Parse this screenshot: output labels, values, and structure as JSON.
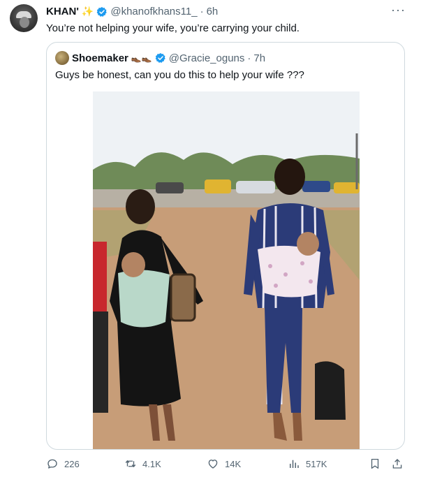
{
  "author": {
    "name": "KHAN'",
    "emoji": "✨",
    "handle": "@khanofkhans11_",
    "separator": "·",
    "time": "6h",
    "more_label": "···"
  },
  "tweet_text": "You’re not helping your wife, you’re carrying your child.",
  "quoted": {
    "name": "Shoemaker",
    "emoji": "👞👞",
    "handle": "@Gracie_oguns",
    "separator": "·",
    "time": "7h",
    "text": "Guys be honest, can you do this to help your wife ???"
  },
  "metrics": {
    "replies": "226",
    "reposts": "4.1K",
    "likes": "14K",
    "views": "517K"
  },
  "icons": {
    "reply": "speech-bubble-icon",
    "repost": "repost-arrows-icon",
    "like": "heart-icon",
    "views": "bar-chart-icon",
    "bookmark": "bookmark-icon",
    "share": "share-upload-icon",
    "verified": "verified-badge-icon"
  },
  "colors": {
    "verified": "#1d9bf0",
    "text": "#0f1419",
    "secondary": "#536471",
    "border": "#cfd9de"
  }
}
